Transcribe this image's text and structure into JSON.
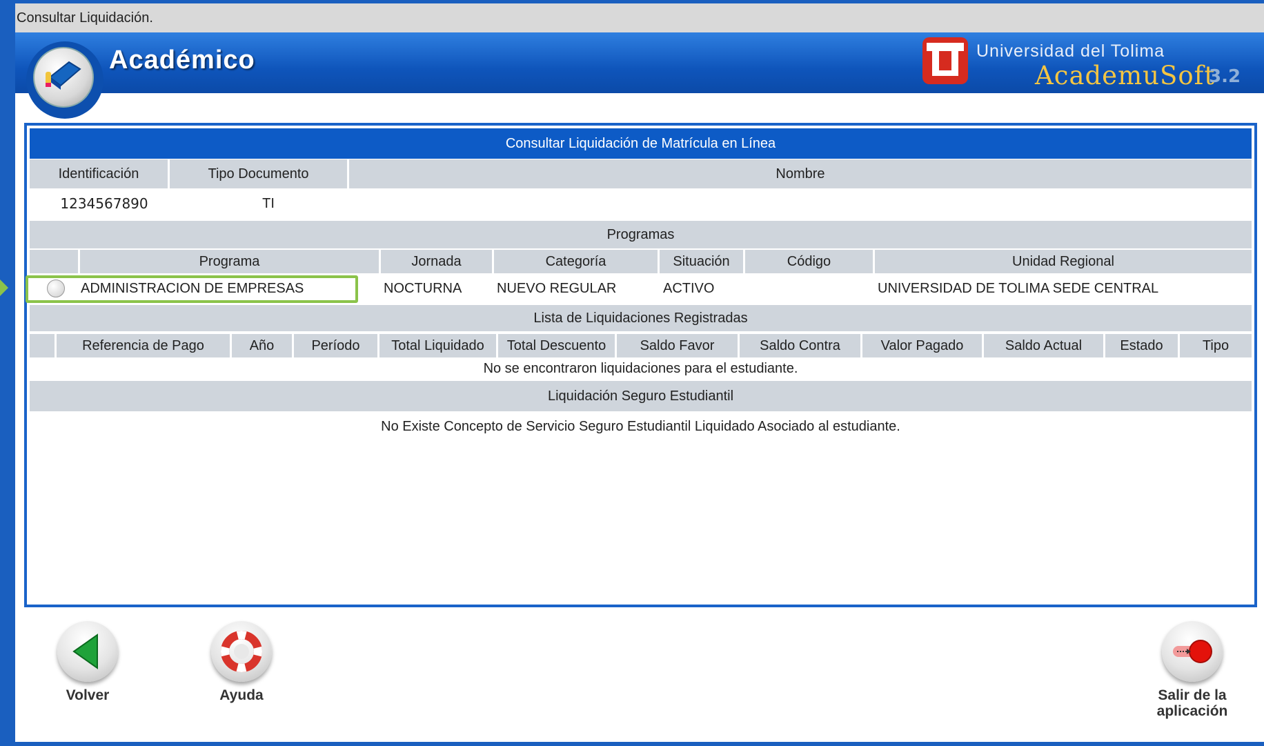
{
  "window": {
    "title": "Consultar Liquidación."
  },
  "header": {
    "app_title": "Académico",
    "university": "Universidad del Tolima",
    "software": "AcademuSoft",
    "version": "3.2"
  },
  "panel": {
    "title": "Consultar Liquidación de Matrícula en Línea",
    "student_headers": [
      "Identificación",
      "Tipo Documento",
      "Nombre"
    ],
    "student": {
      "identificacion": "1234567890",
      "tipo_documento": "TI",
      "nombre": ""
    },
    "programas_title": "Programas",
    "program_headers": [
      "Programa",
      "Jornada",
      "Categoría",
      "Situación",
      "Código",
      "Unidad Regional"
    ],
    "program": {
      "programa": "ADMINISTRACION DE EMPRESAS",
      "jornada": "NOCTURNA",
      "categoria": "NUEVO REGULAR",
      "situacion": "ACTIVO",
      "codigo": "",
      "unidad_regional": "UNIVERSIDAD DE TOLIMA SEDE CENTRAL"
    },
    "liquidaciones_title": "Lista de Liquidaciones Registradas",
    "liquidacion_headers": [
      "Referencia de Pago",
      "Año",
      "Período",
      "Total Liquidado",
      "Total Descuento",
      "Saldo Favor",
      "Saldo Contra",
      "Valor Pagado",
      "Saldo Actual",
      "Estado",
      "Tipo"
    ],
    "no_liquidaciones": "No se encontraron liquidaciones para el estudiante.",
    "seguro_title": "Liquidación Seguro Estudiantil",
    "no_seguro": "No Existe Concepto de Servicio Seguro Estudiantil Liquidado Asociado al estudiante."
  },
  "buttons": {
    "volver": "Volver",
    "ayuda": "Ayuda",
    "salir_line1": "Salir de la",
    "salir_line2": "aplicación"
  },
  "colors": {
    "frame_blue": "#1a5fbf",
    "panel_title_blue": "#0d5bc6",
    "header_gray": "#cfd5dc",
    "highlight_green": "#8bc34a",
    "logo_red": "#d62b1f",
    "soft_gold": "#f4c542"
  },
  "icons": {
    "logo": "book-globe-icon",
    "university_logo": "ut-logo-icon",
    "volver": "back-arrow-icon",
    "ayuda": "lifebuoy-icon",
    "salir": "exit-icon"
  }
}
